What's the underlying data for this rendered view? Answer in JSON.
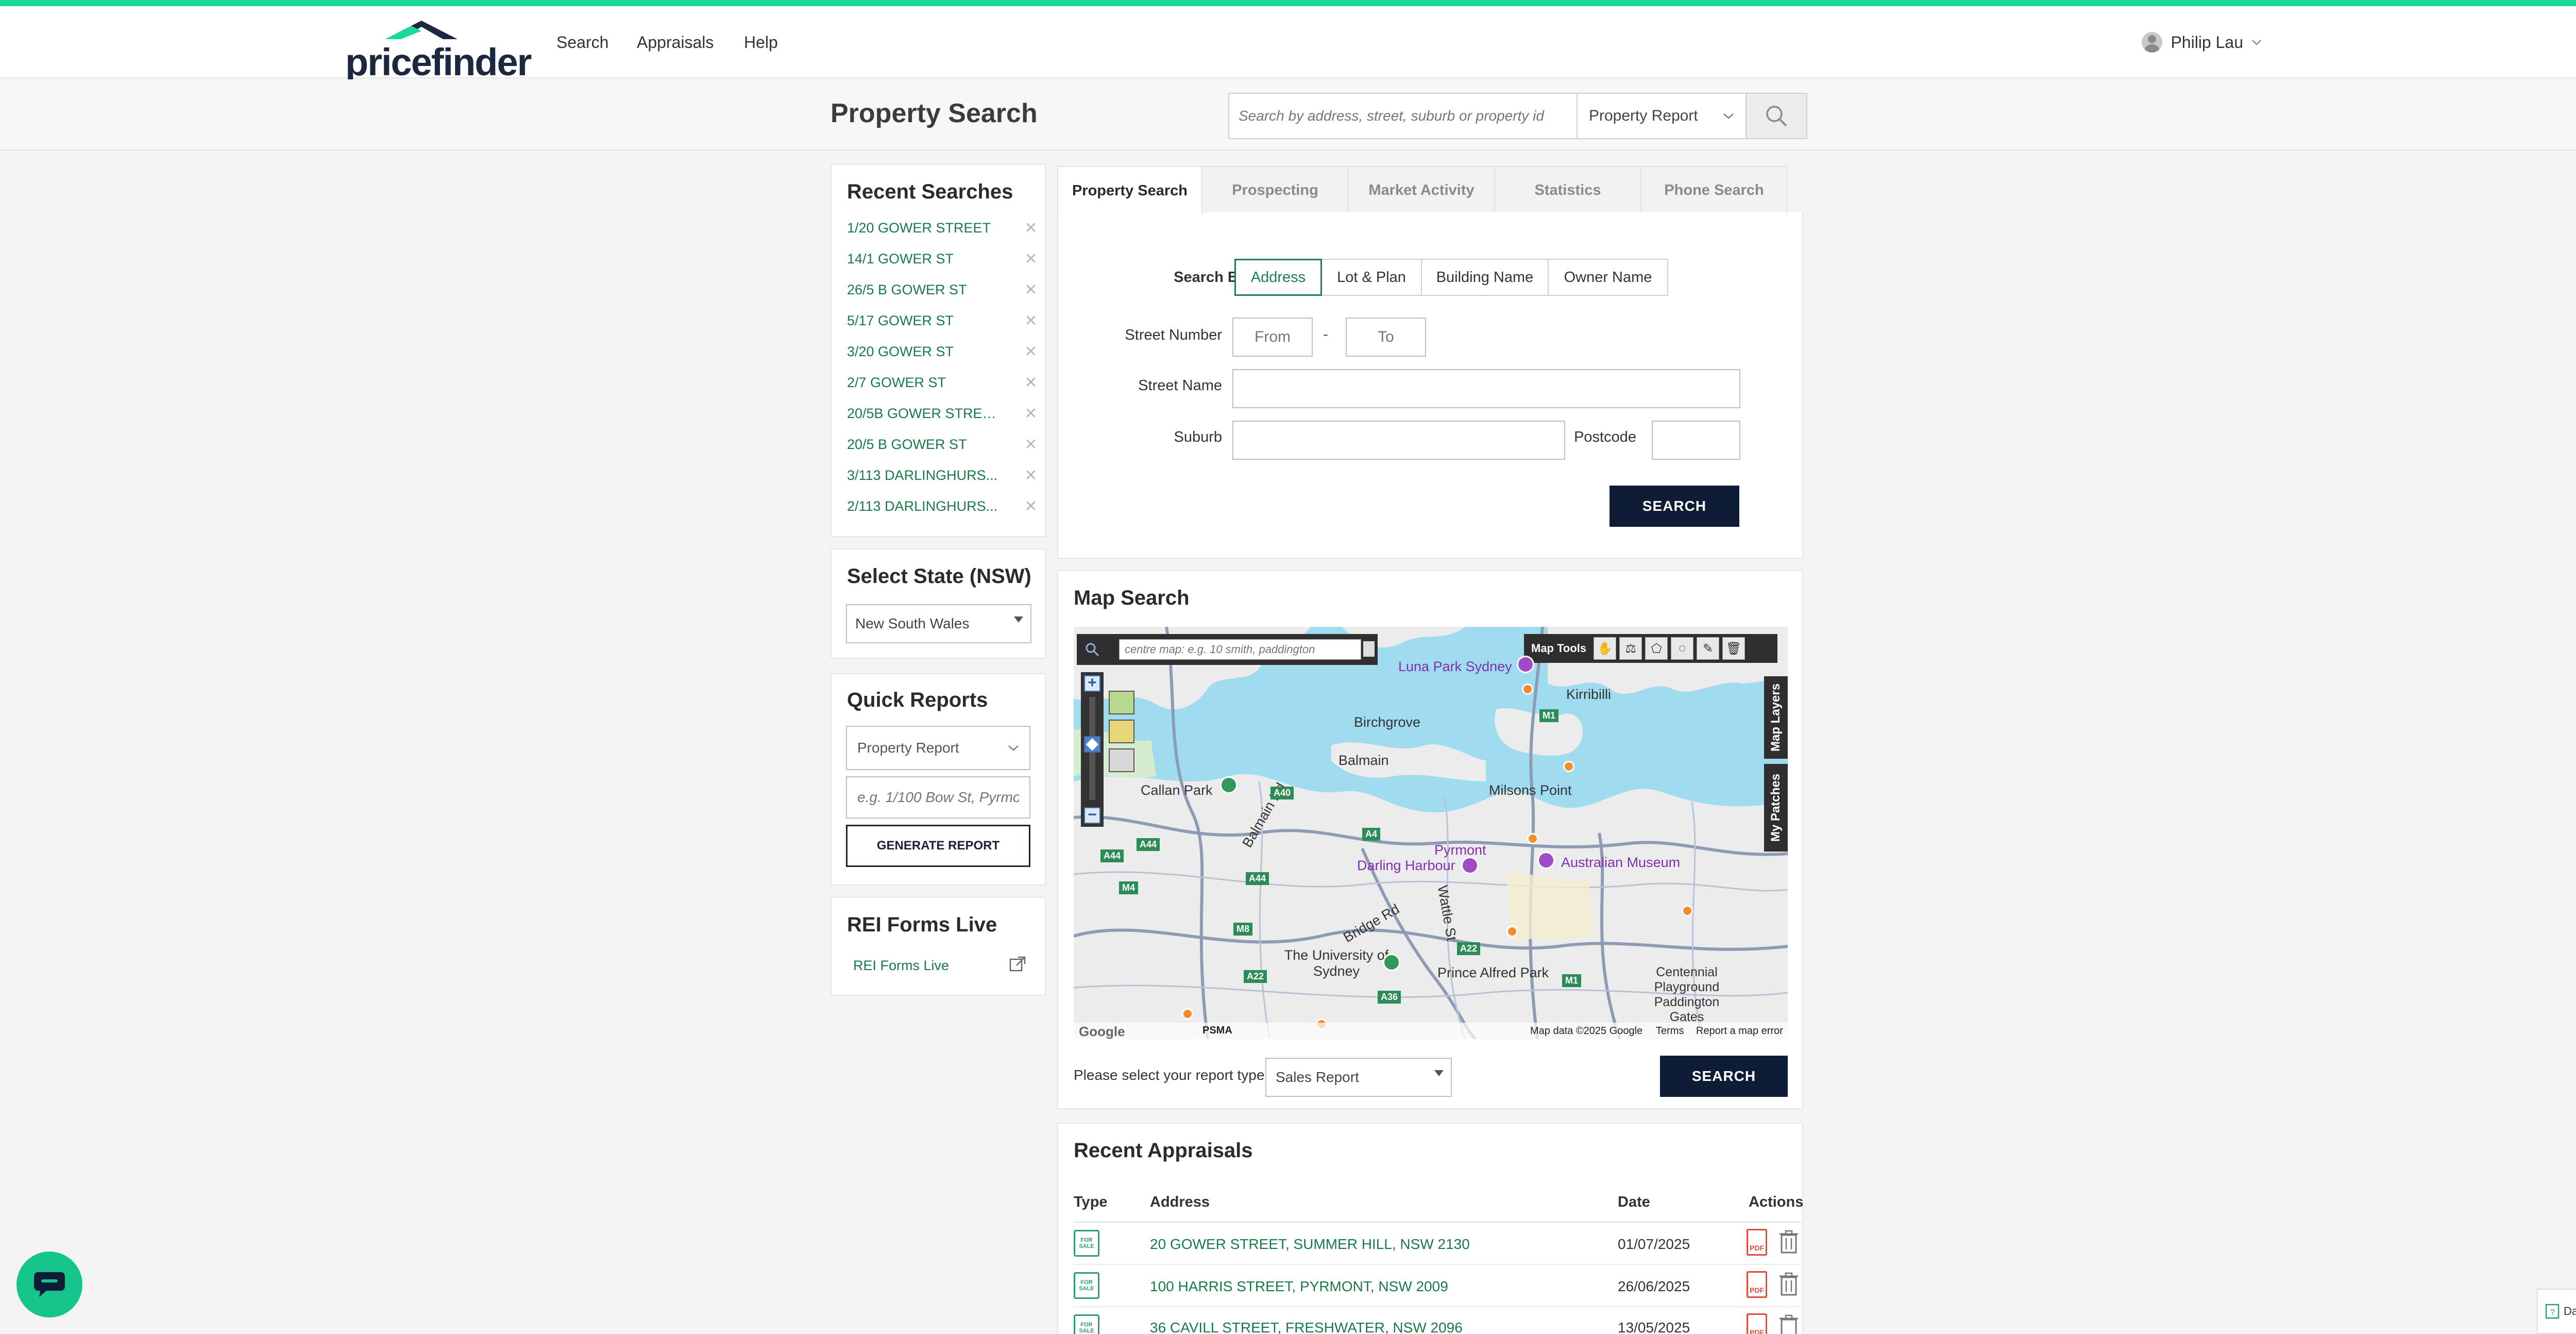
{
  "brand": {
    "name": "pricefinder",
    "accent": "#1ed79e",
    "navy": "#0f1c36",
    "link_green": "#197a48"
  },
  "nav": {
    "items": [
      "Search",
      "Appraisals",
      "Help"
    ]
  },
  "user": {
    "name": "Philip Lau"
  },
  "header": {
    "page_title": "Property Search",
    "search_placeholder": "Search by address, street, suburb or property id",
    "search_type": "Property Report"
  },
  "recent_searches": {
    "title": "Recent Searches",
    "items": [
      "1/20 GOWER STREET",
      "14/1 GOWER ST",
      "26/5 B GOWER ST",
      "5/17 GOWER ST",
      "3/20 GOWER ST",
      "2/7 GOWER ST",
      "20/5B GOWER STREE...",
      "20/5 B GOWER ST",
      "3/113 DARLINGHURS...",
      "2/113 DARLINGHURS..."
    ]
  },
  "select_state": {
    "title": "Select State (NSW)",
    "value": "New South Wales"
  },
  "quick_reports": {
    "title": "Quick Reports",
    "report_type": "Property Report",
    "address_placeholder": "e.g. 1/100 Bow St, Pyrmont",
    "button": "GENERATE REPORT"
  },
  "rei_forms": {
    "title": "REI Forms Live",
    "link": "REI Forms Live"
  },
  "tabs": [
    "Property Search",
    "Prospecting",
    "Market Activity",
    "Statistics",
    "Phone Search"
  ],
  "property_form": {
    "search_by_label": "Search By",
    "search_by_options": [
      "Address",
      "Lot & Plan",
      "Building Name",
      "Owner Name"
    ],
    "street_number_label": "Street Number",
    "from_placeholder": "From",
    "to_placeholder": "To",
    "dash": "-",
    "street_name_label": "Street Name",
    "suburb_label": "Suburb",
    "postcode_label": "Postcode",
    "search_button": "SEARCH"
  },
  "map_search": {
    "title": "Map Search",
    "centre_placeholder": "centre map: e.g. 10 smith, paddington",
    "map_tools_label": "Map Tools",
    "side_tabs": [
      "Map Layers",
      "My Patches"
    ],
    "labels": [
      "Luna Park Sydney",
      "Kirribilli",
      "Birchgrove",
      "Balmain",
      "Callan Park",
      "Milsons Point",
      "Pyrmont",
      "Darling Harbour",
      "Australian Museum",
      "Balmain Rd",
      "Bridge Rd",
      "Wattle St",
      "The University of Sydney",
      "Prince Alfred Park",
      "Centennial Playground Paddington Gates"
    ],
    "road_badges": [
      "M1",
      "A40",
      "A4",
      "A44",
      "A44",
      "M4",
      "A44",
      "M8",
      "A22",
      "A22",
      "A36",
      "M1"
    ],
    "attribution": {
      "google": "Google",
      "psma": "PSMA",
      "data": "Map data ©2025 Google",
      "terms": "Terms",
      "report": "Report a map error"
    },
    "report_type_label": "Please select your report type",
    "report_type_value": "Sales Report",
    "search_button": "SEARCH"
  },
  "recent_appraisals": {
    "title": "Recent Appraisals",
    "columns": [
      "Type",
      "Address",
      "Date",
      "Actions"
    ],
    "type_badge": "FOR SALE",
    "pdf_label": "PDF",
    "rows": [
      {
        "address": "20 GOWER STREET, SUMMER HILL, NSW 2130",
        "date": "01/07/2025"
      },
      {
        "address": "100 HARRIS STREET, PYRMONT, NSW 2009",
        "date": "26/06/2025"
      },
      {
        "address": "36 CAVILL STREET, FRESHWATER, NSW 2096",
        "date": "13/05/2025"
      }
    ]
  },
  "data_update": "Data Update"
}
